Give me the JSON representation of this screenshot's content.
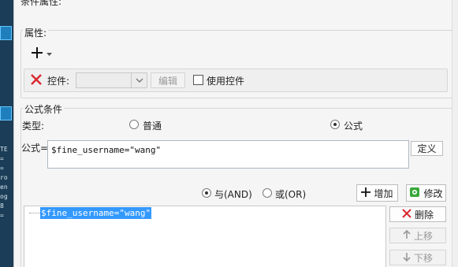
{
  "dialog": {
    "title": "条件属性:"
  },
  "properties": {
    "legend": "属性:",
    "add_symbol": "+",
    "control_label": "控件:",
    "control_value": "",
    "edit_button": "编辑",
    "use_control_label": "使用控件",
    "use_control_checked": false
  },
  "formula_condition": {
    "legend": "公式条件",
    "type_label": "类型:",
    "types": [
      {
        "label": "普通",
        "selected": false
      },
      {
        "label": "公式",
        "selected": true
      }
    ],
    "formula_label": "公式=",
    "formula_value": "$fine_username=\"wang\"",
    "define_button": "定义",
    "logic": [
      {
        "label": "与(AND)",
        "selected": true
      },
      {
        "label": "或(OR)",
        "selected": false
      }
    ],
    "add_button": "增加",
    "modify_button": "修改",
    "delete_button": "删除",
    "move_up_button": "上移",
    "move_down_button": "下移",
    "tree_items": [
      "$fine_username=\"wang\""
    ]
  },
  "left_strip": {
    "lines": [
      "TE",
      "=",
      "=",
      "ro",
      "en",
      "og",
      "8",
      "="
    ]
  },
  "colors": {
    "selection_bg": "#3399ff",
    "delete_red": "#d9272e",
    "add_green": "#3aa83a",
    "left_strip_bg": "#1b3d57"
  }
}
